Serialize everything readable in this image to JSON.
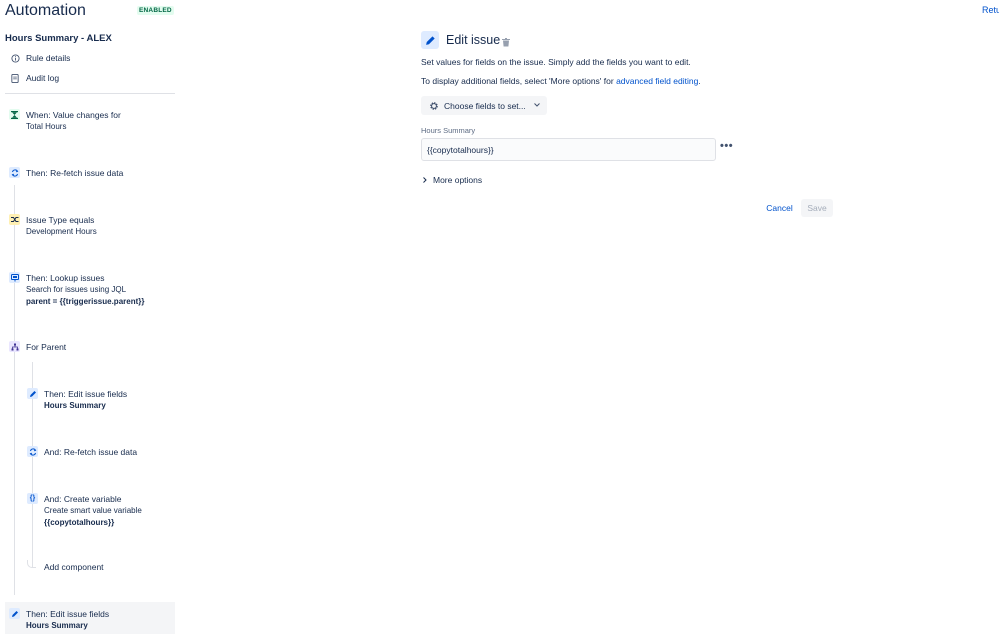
{
  "header": {
    "title": "Automation",
    "status_badge": "ENABLED",
    "return_link": "Retu"
  },
  "sidebar": {
    "rule_name": "Hours Summary - ALEX",
    "nav": [
      {
        "label": "Rule details",
        "icon": "info-icon"
      },
      {
        "label": "Audit log",
        "icon": "document-icon"
      }
    ]
  },
  "components": [
    {
      "title": "When: Value changes for",
      "sub": "Total Hours",
      "icon": "trigger-icon",
      "color": "#006644"
    },
    {
      "title": "Then: Re-fetch issue data",
      "icon": "refresh-icon",
      "color": "#0052cc"
    },
    {
      "title": "Issue Type equals",
      "sub": "Development Hours",
      "icon": "condition-icon",
      "color": "#ff991f"
    },
    {
      "title": "Then: Lookup issues",
      "sub": "Search for issues using JQL",
      "sub_bold": "parent = {{triggerissue.parent}}",
      "icon": "lookup-icon",
      "color": "#0052cc"
    },
    {
      "title": "For Parent",
      "icon": "branch-icon",
      "color": "#403294"
    },
    {
      "title": "Then: Edit issue fields",
      "sub_bold": "Hours Summary",
      "icon": "edit-icon",
      "color": "#0052cc"
    },
    {
      "title": "And: Re-fetch issue data",
      "icon": "refresh-icon",
      "color": "#0052cc"
    },
    {
      "title": "And: Create variable",
      "sub": "Create smart value variable",
      "sub_bold": "{{copytotalhours}}",
      "icon": "variable-icon",
      "color": "#0052cc"
    },
    {
      "title": "Add component"
    },
    {
      "title": "Then: Edit issue fields",
      "sub_bold": "Hours Summary",
      "icon": "edit-icon",
      "color": "#0052cc"
    }
  ],
  "editor": {
    "title": "Edit issue",
    "desc1": "Set values for fields on the issue. Simply add the fields you want to edit.",
    "desc2_prefix": "To display additional fields, select 'More options' for ",
    "desc2_link": "advanced field editing",
    "desc2_suffix": ".",
    "choose_fields": "Choose fields to set...",
    "field_label": "Hours Summary",
    "field_value": "{{copytotalhours}}",
    "more_options": "More options",
    "cancel": "Cancel",
    "save": "Save"
  }
}
